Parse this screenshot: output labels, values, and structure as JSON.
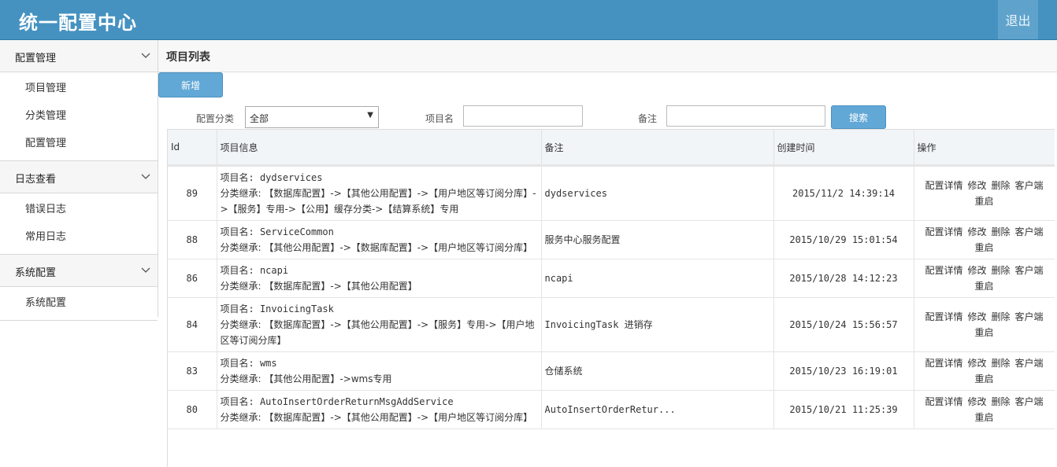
{
  "header": {
    "title": "统一配置中心",
    "logout": "退出"
  },
  "sidebar": {
    "groups": [
      {
        "label": "配置管理",
        "items": [
          "项目管理",
          "分类管理",
          "配置管理"
        ]
      },
      {
        "label": "日志查看",
        "items": [
          "错误日志",
          "常用日志"
        ]
      },
      {
        "label": "系统配置",
        "items": [
          "系统配置"
        ]
      }
    ]
  },
  "main": {
    "breadcrumb": "项目列表",
    "add_button": "新增",
    "search": {
      "category_label": "配置分类",
      "category_value": "全部",
      "name_label": "项目名",
      "name_value": "",
      "remark_label": "备注",
      "remark_value": "",
      "search_button": "搜索"
    },
    "table": {
      "headers": [
        "Id",
        "项目信息",
        "备注",
        "创建时间",
        "操作"
      ],
      "ops": [
        "配置详情",
        "修改",
        "删除",
        "客户端",
        "重启"
      ],
      "rows": [
        {
          "id": "89",
          "name": "项目名: dydservices",
          "inherit": "分类继承: 【数据库配置】->【其他公用配置】->【用户地区等订阅分库】->【服务】专用->【公用】缓存分类->【结算系统】专用",
          "remark": "dydservices",
          "time": "2015/11/2 14:39:14"
        },
        {
          "id": "88",
          "name": "项目名: ServiceCommon",
          "inherit": "分类继承: 【其他公用配置】->【数据库配置】->【用户地区等订阅分库】",
          "remark": "服务中心服务配置",
          "time": "2015/10/29 15:01:54"
        },
        {
          "id": "86",
          "name": "项目名: ncapi",
          "inherit": "分类继承: 【数据库配置】->【其他公用配置】",
          "remark": "ncapi",
          "time": "2015/10/28 14:12:23"
        },
        {
          "id": "84",
          "name": "项目名: InvoicingTask",
          "inherit": "分类继承: 【数据库配置】->【其他公用配置】->【服务】专用->【用户地区等订阅分库】",
          "remark": "InvoicingTask 进销存",
          "time": "2015/10/24 15:56:57"
        },
        {
          "id": "83",
          "name": "项目名: wms",
          "inherit": "分类继承: 【其他公用配置】->wms专用",
          "remark": "仓储系统",
          "time": "2015/10/23 16:19:01"
        },
        {
          "id": "80",
          "name": "项目名: AutoInsertOrderReturnMsgAddService",
          "inherit": "分类继承: 【数据库配置】->【其他公用配置】->【用户地区等订阅分库】",
          "remark": "AutoInsertOrderRetur...",
          "time": "2015/10/21 11:25:39"
        }
      ]
    }
  }
}
